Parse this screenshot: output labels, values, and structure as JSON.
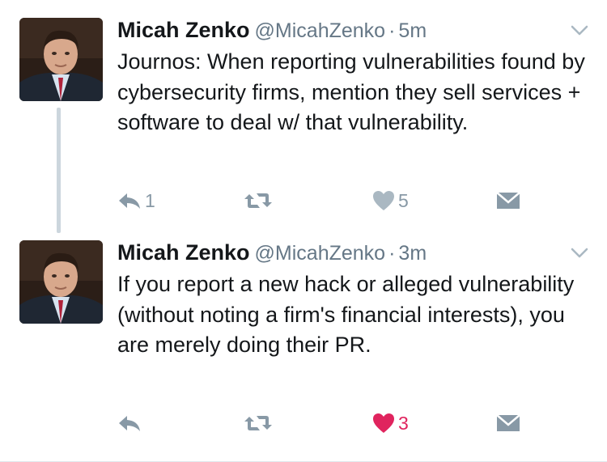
{
  "tweets": [
    {
      "name": "Micah Zenko",
      "handle": "@MicahZenko",
      "separator": "·",
      "time": "5m",
      "text": "Journos: When reporting vulnerabilities found by cybersecurity firms, mention they sell services + software to deal w/ that vulnerability.",
      "reply_count": "1",
      "retweet_count": "",
      "like_count": "5",
      "liked": false
    },
    {
      "name": "Micah Zenko",
      "handle": "@MicahZenko",
      "separator": "·",
      "time": "3m",
      "text": "If you report a new hack or alleged vulnerability (without noting a firm's financial interests), you are merely doing their PR.",
      "reply_count": "",
      "retweet_count": "",
      "like_count": "3",
      "liked": true
    }
  ],
  "icons": {
    "reply": "reply-icon",
    "retweet": "retweet-icon",
    "like": "heart-icon",
    "dm": "envelope-icon",
    "more": "chevron-down-icon"
  },
  "colors": {
    "text": "#14171a",
    "secondary": "#657786",
    "action_gray": "#8899a6",
    "liked": "#e0245e",
    "thread_line": "#ccd6dd"
  }
}
